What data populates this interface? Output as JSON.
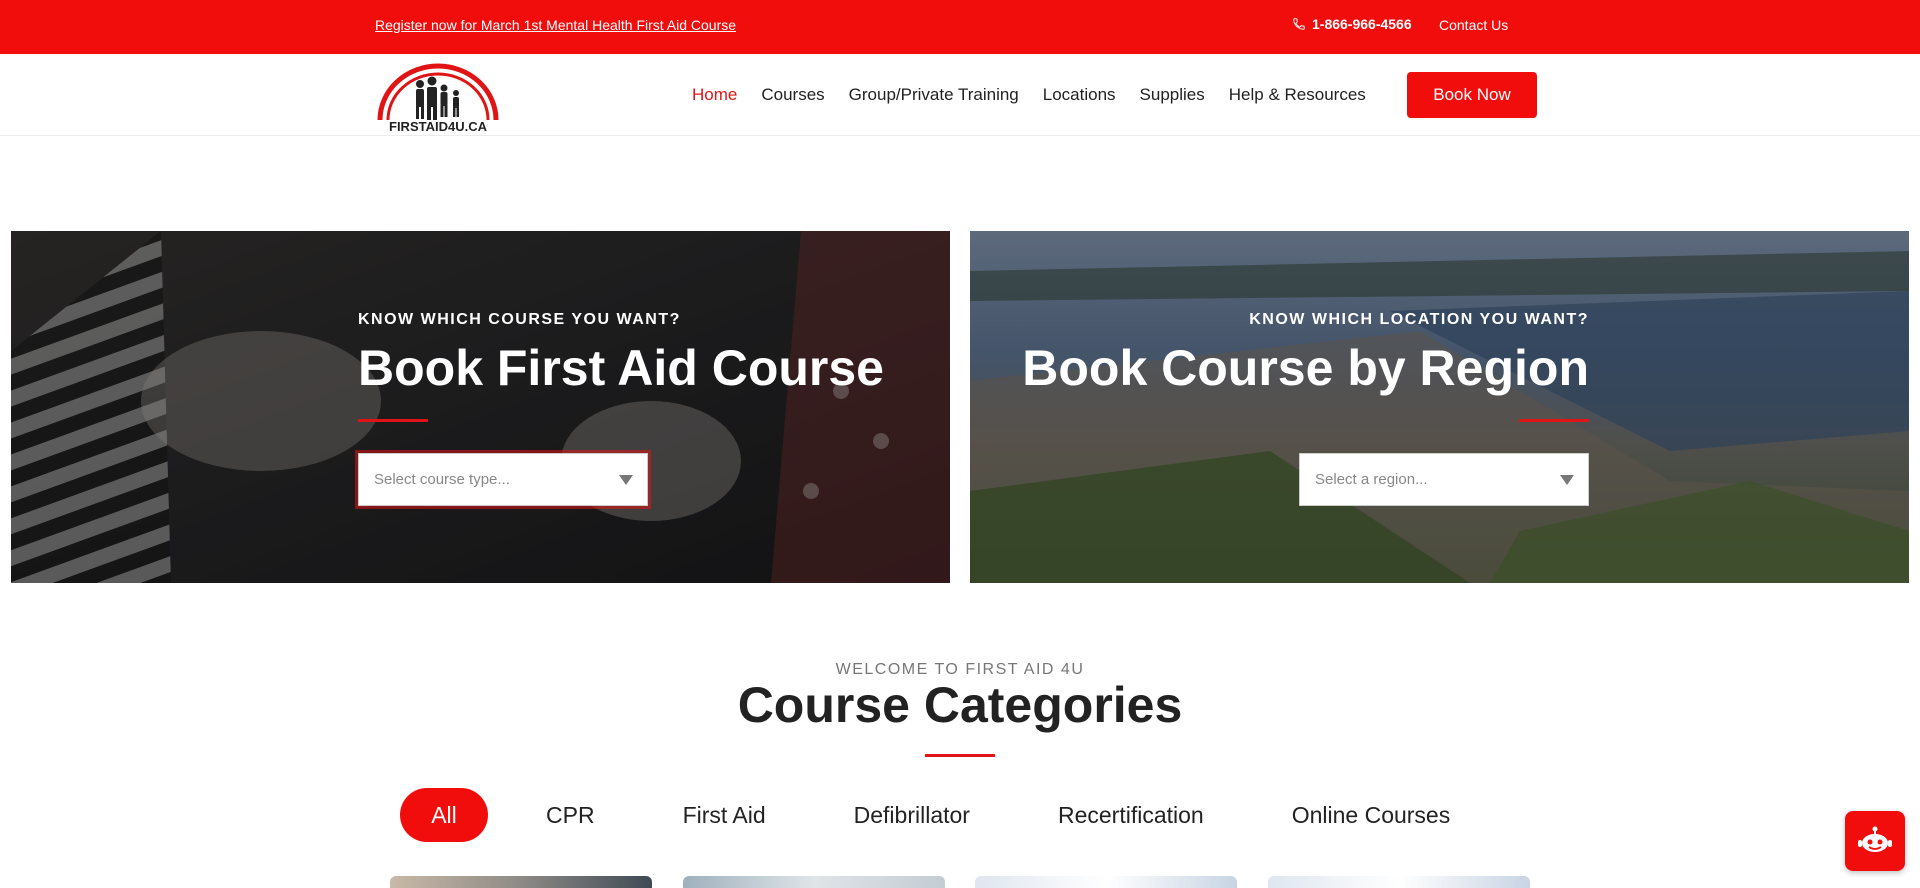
{
  "topbar": {
    "promo_text": "Register now for March 1st Mental Health First Aid Course",
    "phone": "1-866-966-4566",
    "contact_label": "Contact Us"
  },
  "header": {
    "logo_text": "FIRSTAID4U.CA",
    "nav": [
      {
        "label": "Home",
        "active": true
      },
      {
        "label": "Courses",
        "active": false
      },
      {
        "label": "Group/Private Training",
        "active": false
      },
      {
        "label": "Locations",
        "active": false
      },
      {
        "label": "Supplies",
        "active": false
      },
      {
        "label": "Help & Resources",
        "active": false
      }
    ],
    "book_now_label": "Book Now"
  },
  "hero_left": {
    "kicker": "KNOW WHICH COURSE YOU WANT?",
    "title": "Book First Aid Course",
    "select_placeholder": "Select course type..."
  },
  "hero_right": {
    "kicker": "KNOW WHICH LOCATION YOU WANT?",
    "title": "Book Course by Region",
    "select_placeholder": "Select a region..."
  },
  "section": {
    "welcome": "WELCOME TO FIRST AID 4U",
    "title": "Course Categories",
    "filters": [
      {
        "label": "All",
        "active": true
      },
      {
        "label": "CPR",
        "active": false
      },
      {
        "label": "First Aid",
        "active": false
      },
      {
        "label": "Defibrillator",
        "active": false
      },
      {
        "label": "Recertification",
        "active": false
      },
      {
        "label": "Online Courses",
        "active": false
      }
    ]
  },
  "colors": {
    "brand_red": "#f20d0d",
    "accent_red": "#e01414",
    "text_dark": "#222222"
  },
  "icons": {
    "phone": "phone-icon",
    "dropdown": "caret-down-icon",
    "chat": "chatbot-icon"
  }
}
